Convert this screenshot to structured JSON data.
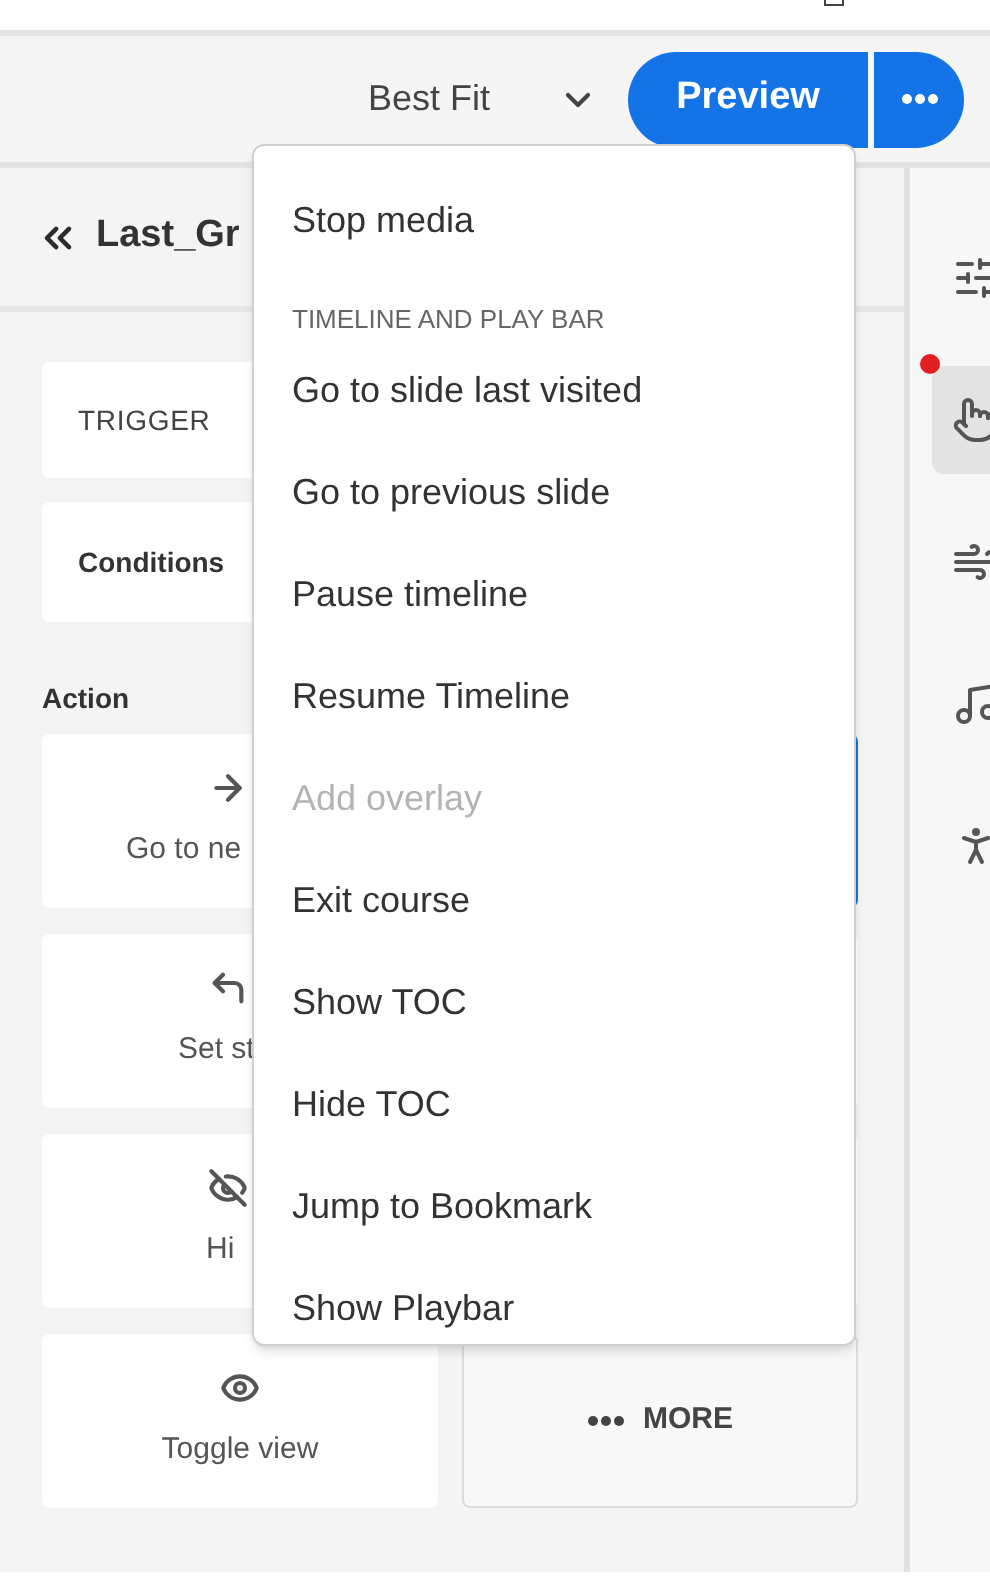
{
  "toolbar": {
    "zoom": "Best Fit",
    "preview": "Preview"
  },
  "panel": {
    "title": "Last_Gr",
    "trigger": "TRIGGER",
    "conditions": "Conditions",
    "action_label": "Action"
  },
  "action_cards": [
    {
      "label": "Go to ne",
      "kind": "arrow"
    },
    {
      "label": "Set st",
      "kind": "state"
    },
    {
      "label": "Hi",
      "kind": "hide"
    },
    {
      "label": "Toggle view",
      "kind": "toggle"
    }
  ],
  "hidden_cards": [
    {
      "selected": true
    },
    {
      "selected": false
    },
    {
      "selected": false
    }
  ],
  "more": "MORE",
  "rail": [
    {
      "kind": "sliders",
      "selected": false,
      "notification": false
    },
    {
      "kind": "touch",
      "selected": true,
      "notification": true
    },
    {
      "kind": "motion",
      "selected": false,
      "notification": false
    },
    {
      "kind": "audio",
      "selected": false,
      "notification": false
    },
    {
      "kind": "access",
      "selected": false,
      "notification": false
    }
  ],
  "menu": [
    {
      "kind": "item",
      "label": "Stop media",
      "disabled": false
    },
    {
      "kind": "divider"
    },
    {
      "kind": "header",
      "label": "TIMELINE AND PLAY BAR"
    },
    {
      "kind": "item",
      "label": "Go to slide last visited",
      "disabled": false
    },
    {
      "kind": "item",
      "label": "Go to previous slide",
      "disabled": false
    },
    {
      "kind": "item",
      "label": "Pause timeline",
      "disabled": false
    },
    {
      "kind": "item",
      "label": "Resume Timeline",
      "disabled": false
    },
    {
      "kind": "item",
      "label": "Add overlay",
      "disabled": true
    },
    {
      "kind": "item",
      "label": "Exit course",
      "disabled": false
    },
    {
      "kind": "item",
      "label": "Show TOC",
      "disabled": false
    },
    {
      "kind": "item",
      "label": "Hide TOC",
      "disabled": false
    },
    {
      "kind": "item",
      "label": "Jump to Bookmark",
      "disabled": false
    },
    {
      "kind": "item",
      "label": "Show Playbar",
      "disabled": false
    }
  ]
}
